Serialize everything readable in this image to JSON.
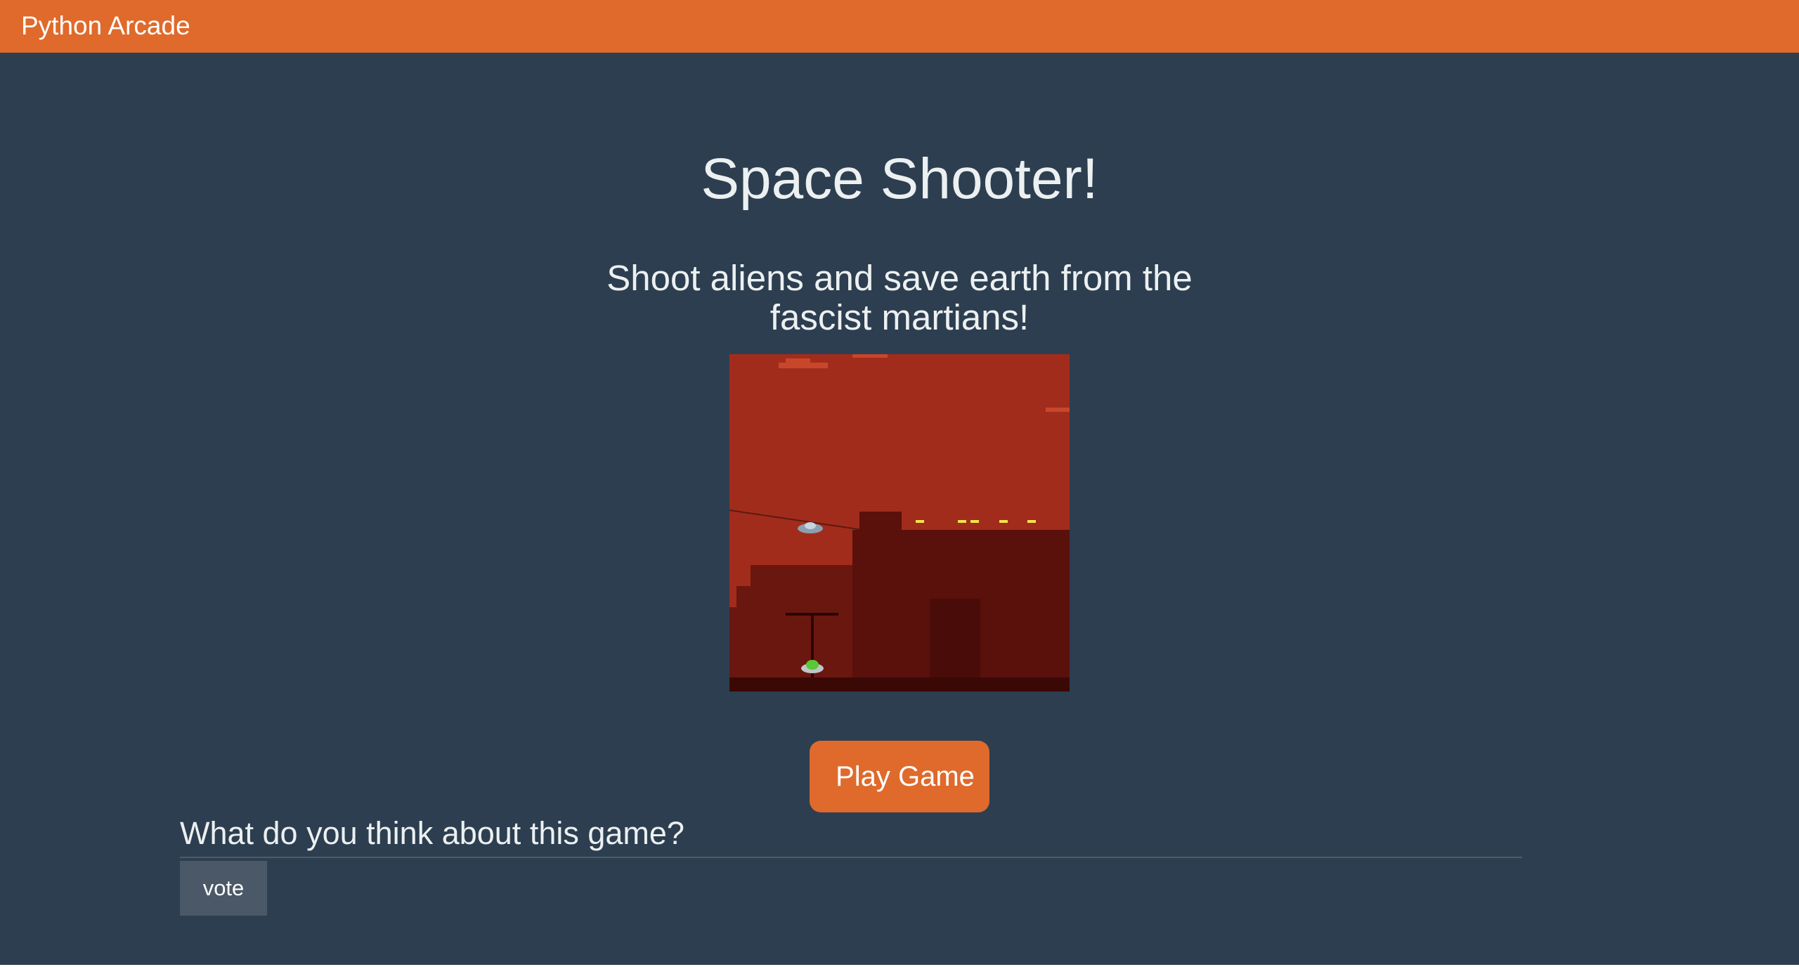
{
  "navbar": {
    "brand": "Python Arcade",
    "color": "#df6a2b"
  },
  "game": {
    "title": "Space Shooter!",
    "description": "Shoot aliens and save earth from the fascist martians!",
    "play_label": "Play Game"
  },
  "feedback": {
    "heading": "What do you think about this game?",
    "vote_label": "vote"
  },
  "colors": {
    "background": "#2d3e50",
    "accent": "#df6a2b",
    "text": "#ecf0f1",
    "vote_button": "#4a5867"
  }
}
